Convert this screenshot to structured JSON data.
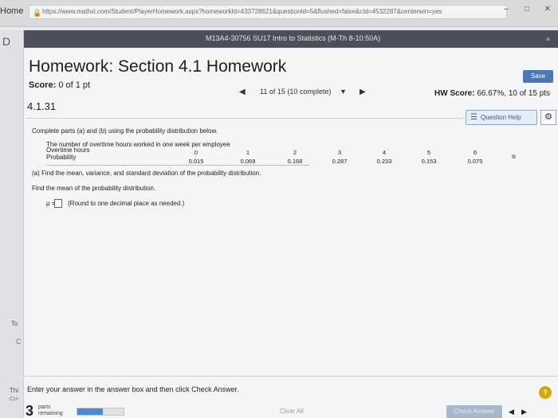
{
  "browser": {
    "home_tab": "Home",
    "url": "https://www.mathxl.com/Student/PlayerHomework.aspx?homeworkId=433728621&questionId=5&flushed=false&cId=4532287&centerwin=yes",
    "minimize": "–",
    "maximize": "□",
    "close": "✕"
  },
  "course": {
    "title": "M13A4-30756 SU17 Intro to Statistics (M-Th 8-10:50A)"
  },
  "sidebar": {
    "d": "D",
    "to": "To",
    "c": "C",
    "th": "Thi",
    "co": "Cor"
  },
  "homework": {
    "title": "Homework: Section 4.1 Homework",
    "save_label": "Save",
    "score_label": "Score:",
    "score_value": "0 of 1 pt",
    "progress_text": "11 of 15 (10 complete)",
    "hw_score_label": "HW Score:",
    "hw_score_value": "66.67%, 10 of 15 pts"
  },
  "question": {
    "number": "4.1.31",
    "help_label": "Question Help",
    "instruction": "Complete parts (a) and (b) using the probability distribution below.",
    "description": "The number of overtime hours worked in one week per employee",
    "overtime_label": "Overtime hours",
    "probability_label": "Probability",
    "hours": [
      "0",
      "1",
      "2",
      "3",
      "4",
      "5",
      "6"
    ],
    "probabilities": [
      "0.015",
      "0.069",
      "0.168",
      "0.287",
      "0.233",
      "0.153",
      "0.075"
    ],
    "part_a": "(a) Find the mean, variance, and standard deviation of the probability distribution.",
    "find_mean": "Find the mean of the probability distribution.",
    "mu_label": "μ =",
    "round_hint": "(Round to one decimal place as needed.)"
  },
  "footer": {
    "enter_text": "Enter your answer in the answer box and then click Check Answer.",
    "help": "?",
    "parts_num": "3",
    "parts_label_1": "parts",
    "parts_label_2": "remaining",
    "progress_fraction": 0.55,
    "clear_all": "Clear All",
    "check_answer": "Check Answer"
  },
  "colors": {
    "course_bar": "#4a4f5a",
    "save_button": "#4a78b6",
    "help_circle": "#d8a600",
    "progress_fill": "#4a8bd4"
  }
}
